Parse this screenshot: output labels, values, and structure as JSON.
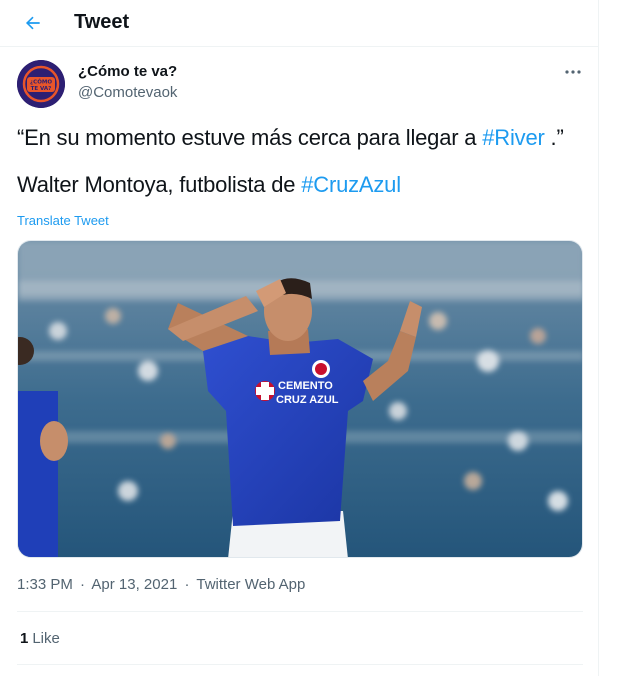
{
  "header": {
    "title": "Tweet"
  },
  "author": {
    "display_name": "¿Cómo te va?",
    "handle": "@Comotevaok",
    "avatar_text_line1": "¿CÓMO",
    "avatar_text_line2": "TE VA?"
  },
  "tweet": {
    "line1_prefix": "“En su momento estuve más cerca para llegar a ",
    "line1_hashtag": "#River",
    "line1_suffix": " .”",
    "line2_prefix": "Walter Montoya, futbolista de ",
    "line2_hashtag": "#CruzAzul",
    "translate_label": "Translate Tweet"
  },
  "media": {
    "jersey_text_line1": "CEMENTO",
    "jersey_text_line2": "CRUZ AZUL"
  },
  "meta": {
    "time": "1:33 PM",
    "separator": "·",
    "date": "Apr 13, 2021",
    "app": "Twitter Web App"
  },
  "engagement": {
    "likes_count": "1",
    "likes_label": "Like"
  },
  "colors": {
    "accent": "#1d9bf0",
    "secondary_text": "#536471",
    "jersey_blue": "#1f3fb8"
  }
}
